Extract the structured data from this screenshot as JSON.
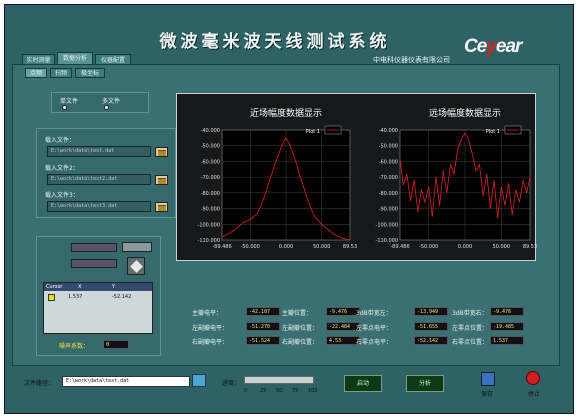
{
  "header": {
    "title": "微波毫米波天线测试系统",
    "logo_main": "Ce",
    "logo_accent": "y",
    "logo_tail": "ear",
    "company": "中电科仪器仪表有限公司"
  },
  "tabs": [
    "实时测量",
    "数据分析",
    "仪器配置"
  ],
  "subtabs": [
    "点频",
    "扫频",
    "极坐标"
  ],
  "file_mode": {
    "single": "单文件",
    "multi": "多文件"
  },
  "files": [
    {
      "label": "载入文件：",
      "path": "E:\\work\\data\\test.dat"
    },
    {
      "label": "载入文件2：",
      "path": "E:\\work\\data\\test2.dat"
    },
    {
      "label": "载入文件3：",
      "path": "E:\\work\\data\\test3.dat"
    }
  ],
  "cursor_table": {
    "headers": [
      "Cursor",
      "X",
      "Y"
    ],
    "row": {
      "x": "1.537",
      "y": "-52.142"
    }
  },
  "noise": {
    "label": "噪声系数：",
    "value": "0"
  },
  "charts": [
    {
      "title": "近场幅度数据显示",
      "legend": "Plot 1"
    },
    {
      "title": "远场幅度数据显示",
      "legend": "Plot 1"
    }
  ],
  "chart_data": [
    {
      "type": "line",
      "title": "近场幅度数据显示",
      "legend": "Plot 1",
      "xlim": [
        -89.486,
        89.53
      ],
      "ylim": [
        -110,
        -40
      ],
      "x_ticks": [
        "-89.486",
        "-50.000",
        "0.000",
        "50.000",
        "89.53"
      ],
      "y_ticks": [
        "-40.000",
        "-50.000",
        "-60.000",
        "-70.000",
        "-80.000",
        "-90.000",
        "-100.000",
        "-110.000"
      ],
      "x": [
        -89.486,
        -80,
        -70,
        -60,
        -50,
        -40,
        -35,
        -30,
        -25,
        -20,
        -15,
        -10,
        -5,
        0,
        5,
        10,
        15,
        20,
        25,
        30,
        35,
        40,
        50,
        60,
        70,
        80,
        89.53
      ],
      "y": [
        -108,
        -106,
        -103,
        -99,
        -97,
        -93,
        -88,
        -82,
        -75,
        -68,
        -61,
        -55,
        -49,
        -45,
        -49,
        -55,
        -62,
        -70,
        -77,
        -84,
        -90,
        -95,
        -100,
        -104,
        -107,
        -109,
        -110
      ]
    },
    {
      "type": "line",
      "title": "远场幅度数据显示",
      "legend": "Plot 1",
      "xlim": [
        -89.486,
        89.53
      ],
      "ylim": [
        -110,
        -40
      ],
      "x_ticks": [
        "-89.486",
        "-50.000",
        "0.000",
        "50.000",
        "89.53"
      ],
      "y_ticks": [
        "-40.000",
        "-50.000",
        "-60.000",
        "-70.000",
        "-80.000",
        "-90.000",
        "-100.000",
        "-110.000"
      ],
      "x": [
        -89.486,
        -85,
        -80,
        -75,
        -70,
        -65,
        -60,
        -55,
        -50,
        -45,
        -40,
        -35,
        -30,
        -25,
        -20,
        -15,
        -10,
        -5,
        0,
        5,
        10,
        15,
        20,
        25,
        30,
        35,
        40,
        45,
        50,
        55,
        60,
        65,
        70,
        75,
        80,
        85,
        89.53
      ],
      "y": [
        -58,
        -75,
        -68,
        -85,
        -72,
        -92,
        -78,
        -86,
        -76,
        -95,
        -70,
        -88,
        -66,
        -80,
        -62,
        -68,
        -52,
        -46,
        -42,
        -46,
        -55,
        -66,
        -62,
        -82,
        -68,
        -90,
        -72,
        -96,
        -76,
        -88,
        -74,
        -94,
        -78,
        -86,
        -72,
        -80,
        -70
      ]
    }
  ],
  "stats": [
    {
      "label": "主瓣电平：",
      "value": "-42.107"
    },
    {
      "label": "主瓣位置：",
      "value": "-9.476"
    },
    {
      "label": "3dB带宽左：",
      "value": "-13.949"
    },
    {
      "label": "3dB带宽右：",
      "value": "-9.476"
    },
    {
      "label": "左副瓣电平：",
      "value": "-51.270"
    },
    {
      "label": "左副瓣位置：",
      "value": "-22.484"
    },
    {
      "label": "左零点电平：",
      "value": "-51.655"
    },
    {
      "label": "左零点位置：",
      "value": "-19.485"
    },
    {
      "label": "右副瓣电平：",
      "value": "-51.524"
    },
    {
      "label": "右副瓣位置：",
      "value": "4.53"
    },
    {
      "label": "右零点电平：",
      "value": "-52.142"
    },
    {
      "label": "右零点位置：",
      "value": "1.537"
    }
  ],
  "footer": {
    "path_label": "文件路径：",
    "path": "E:\\work\\data\\test.dat",
    "progress_label": "进度：",
    "progress_ticks": [
      "0",
      "25",
      "50",
      "75",
      "100"
    ],
    "progress": 0,
    "start": "启动",
    "analyze": "分析",
    "save": "保存",
    "stop": "停止"
  }
}
